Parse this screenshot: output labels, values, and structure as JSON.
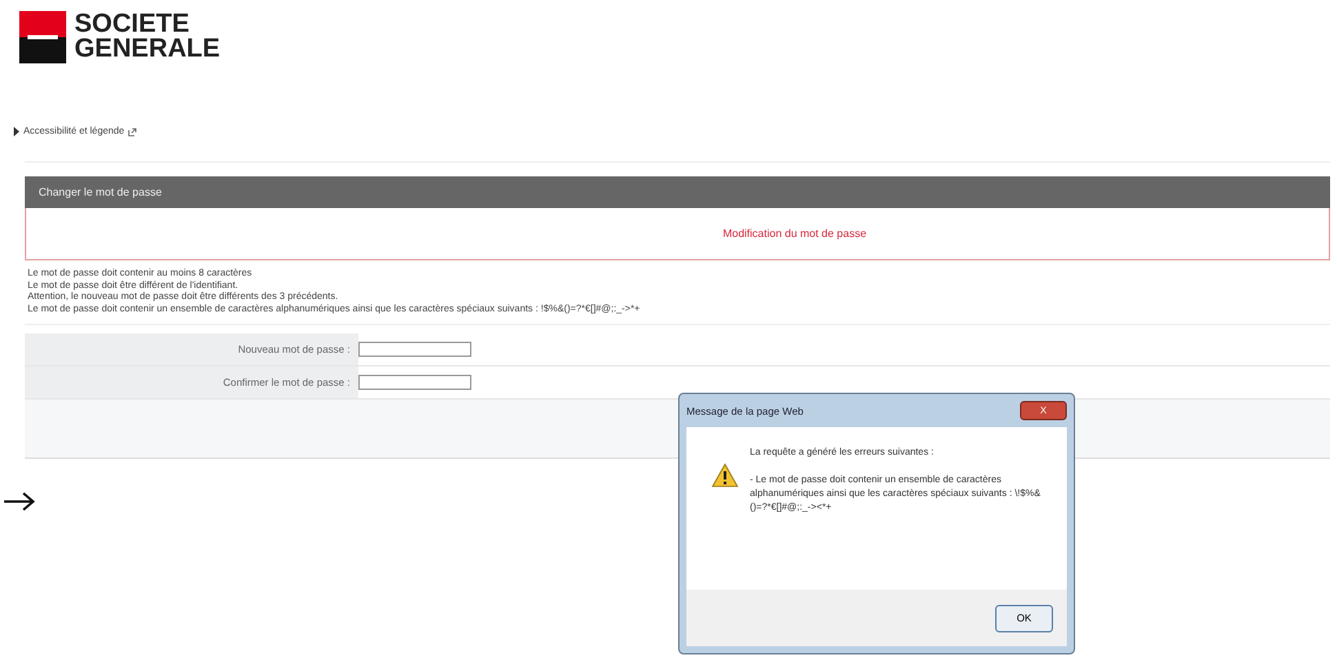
{
  "logo": {
    "line_1": "SOCIETE",
    "line_2": "GENERALE"
  },
  "accessibility_link": "Accessibilité et légende",
  "panel": {
    "title": "Changer le mot de passe",
    "subtitle": "Modification du mot de passe",
    "rules": [
      "Le mot de passe doit contenir au moins 8 caractères",
      "Le mot de passe doit être différent de l'identifiant.",
      "Attention, le nouveau mot de passe doit être différents des 3 précédents.",
      "Le mot de passe doit contenir un ensemble de caractères alphanumériques ainsi que les caractères spéciaux suivants : !$%&()=?*€[]#@;:_->*+"
    ],
    "fields": [
      {
        "label": "Nouveau mot de passe :"
      },
      {
        "label": "Confirmer le mot de passe :"
      }
    ]
  },
  "dialog": {
    "title": "Message de la page Web",
    "close": "X",
    "heading": "La requête a généré les erreurs suivantes :",
    "message": "- Le mot de passe doit contenir un ensemble de caractères alphanumériques ainsi que les caractères spéciaux suivants : \\!$%&()=?*€[]#@;:_-><*+",
    "button": "OK"
  }
}
